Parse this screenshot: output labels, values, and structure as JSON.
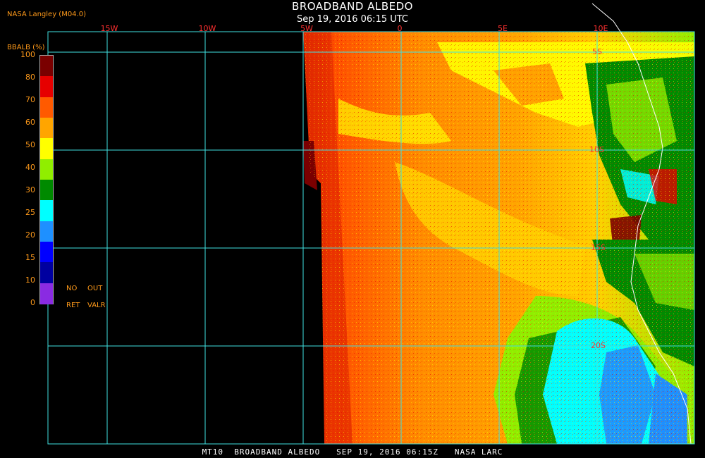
{
  "header": {
    "title": "BROADBAND ALBEDO",
    "subtitle": "Sep 19, 2016 06:15 UTC",
    "credit": "NASA Langley (M04.0)"
  },
  "map": {
    "longitude_labels": [
      "15W",
      "10W",
      "5W",
      "0",
      "5E",
      "10E"
    ],
    "latitude_labels": [
      "5S",
      "10S",
      "15S",
      "20S"
    ],
    "grid_color": "#40e0e0",
    "label_color": "#ff3030"
  },
  "legend": {
    "title": "BBALB (%)",
    "ticks": [
      "100",
      "80",
      "70",
      "60",
      "50",
      "40",
      "30",
      "25",
      "20",
      "15",
      "10",
      "0"
    ],
    "colors": [
      "#7a0000",
      "#e60000",
      "#ff5a00",
      "#ffa500",
      "#ffff00",
      "#90ee00",
      "#008a00",
      "#00ffff",
      "#1e90ff",
      "#0000ff",
      "#0000a0",
      "#8a2be2"
    ],
    "no_ret_top": "NO",
    "no_ret_bottom": "RET",
    "out_valr_top": "OUT",
    "out_valr_bottom": "VALR"
  },
  "footer": {
    "text": "MT10  BROADBAND ALBEDO   SEP 19, 2016 06:15Z   NASA LARC"
  }
}
